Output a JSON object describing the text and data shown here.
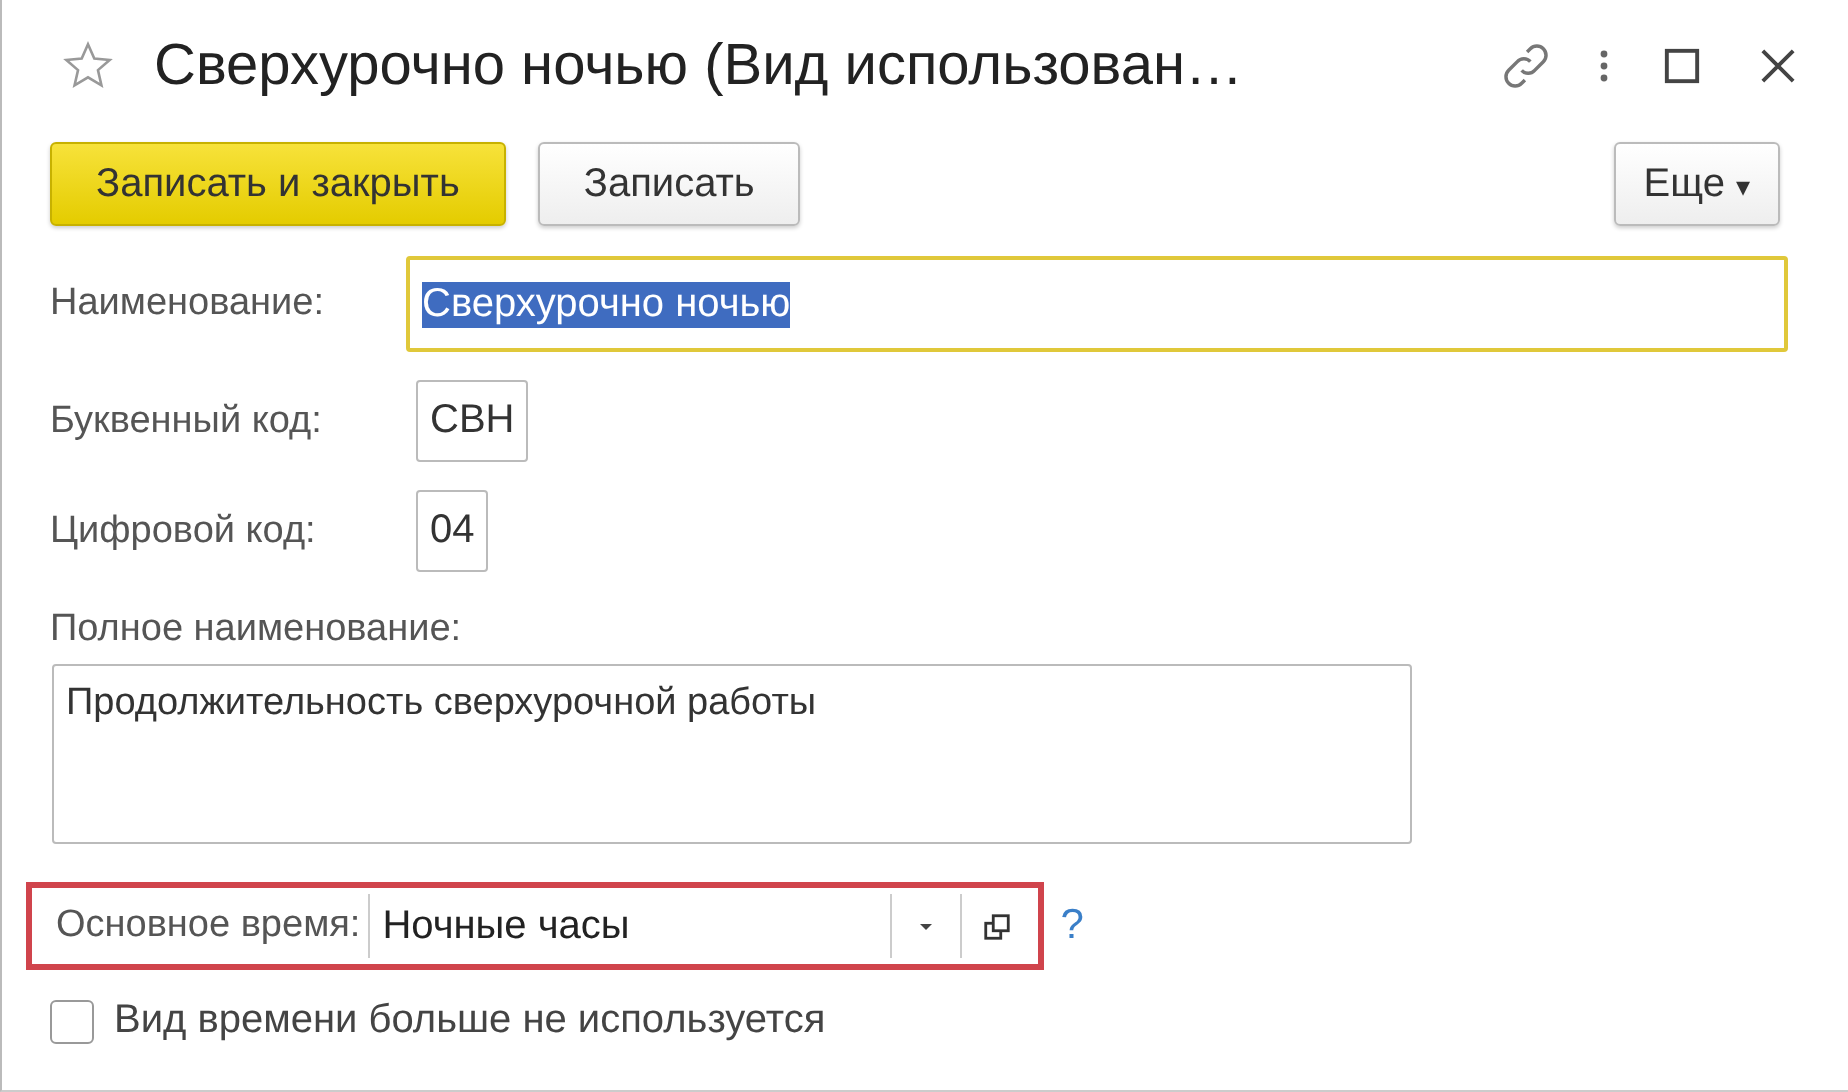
{
  "window": {
    "title": "Сверхурочно ночью (Вид использован…",
    "favorite": false
  },
  "toolbar": {
    "buttons": [
      {
        "label": "Записать и закрыть",
        "kind": "primary"
      },
      {
        "label": "Записать",
        "kind": "normal"
      }
    ],
    "more": {
      "label": "Еще",
      "caret": "▾"
    }
  },
  "fields": [
    {
      "label": "Наименование:",
      "value": "Сверхурочно ночью",
      "focused": true,
      "text_selected": true,
      "kind": "wide"
    },
    {
      "label": "Буквенный код:",
      "value": "СВН",
      "focused": false,
      "text_selected": false,
      "kind": "short"
    },
    {
      "label": "Цифровой код:",
      "value": "04",
      "focused": false,
      "text_selected": false,
      "kind": "short"
    }
  ],
  "full_name": {
    "label": "Полное наименование:",
    "value": "Продолжительность сверхурочной работы"
  },
  "main_time": {
    "label": "Основное время:",
    "value": "Ночные часы",
    "highlighted": true,
    "help": "?"
  },
  "checkbox": {
    "label": "Вид времени больше не используется",
    "checked": false
  }
}
